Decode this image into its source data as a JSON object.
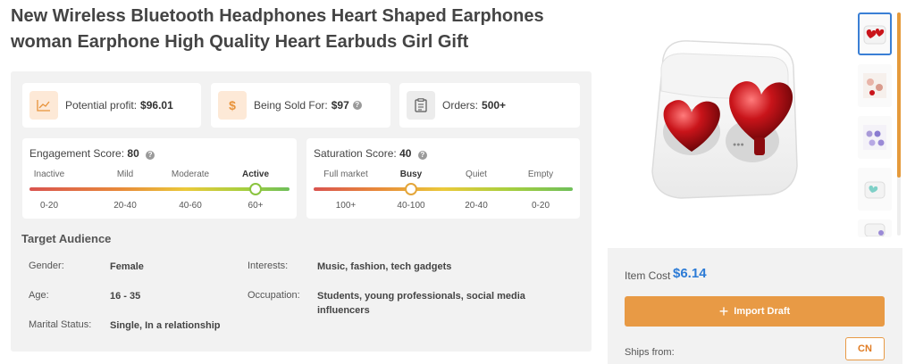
{
  "product": {
    "title_line1": "New Wireless Bluetooth Headphones Heart Shaped Earphones",
    "title_line2": "woman Earphone High Quality Heart Earbuds Girl Gift"
  },
  "stats": {
    "profit": {
      "label": "Potential profit:",
      "value": "$96.01",
      "icon": "chart-line-icon"
    },
    "sold_for": {
      "label": "Being Sold For:",
      "value": "$97",
      "icon": "dollar-icon"
    },
    "orders": {
      "label": "Orders:",
      "value": "500+",
      "icon": "clipboard-icon"
    }
  },
  "engagement": {
    "label": "Engagement Score:",
    "score": "80",
    "levels": [
      "Inactive",
      "Mild",
      "Moderate",
      "Active"
    ],
    "ranges": [
      "0-20",
      "20-40",
      "40-60",
      "60+"
    ],
    "active_index": 3
  },
  "saturation": {
    "label": "Saturation Score:",
    "score": "40",
    "levels": [
      "Full market",
      "Busy",
      "Quiet",
      "Empty"
    ],
    "ranges": [
      "100+",
      "40-100",
      "20-40",
      "0-20"
    ],
    "active_index": 1
  },
  "audience": {
    "title": "Target Audience",
    "gender_label": "Gender:",
    "gender": "Female",
    "age_label": "Age:",
    "age": "16 - 35",
    "marital_label": "Marital Status:",
    "marital": "Single, In a relationship",
    "interests_label": "Interests:",
    "interests": "Music, fashion, tech gadgets",
    "occupation_label": "Occupation:",
    "occupation_line1": "Students, young professionals, social media",
    "occupation_line2": "influencers"
  },
  "purchase": {
    "item_cost_label": "Item Cost",
    "item_cost": "$6.14",
    "import_label": "Import Draft",
    "ships_from_label": "Ships from:",
    "ships_from": "CN"
  },
  "colors": {
    "accent": "#e89a45",
    "link": "#2c7bd6",
    "selected_thumb": "#3a7fd5"
  }
}
